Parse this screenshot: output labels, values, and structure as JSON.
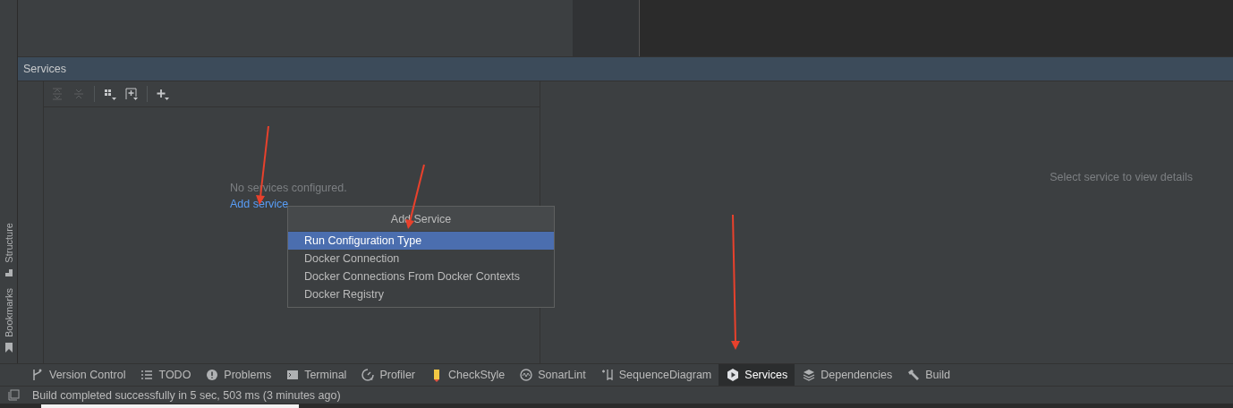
{
  "side_tabs": [
    {
      "label": "Structure",
      "kind": "structure"
    },
    {
      "label": "Bookmarks",
      "kind": "bookmarks"
    }
  ],
  "services_panel": {
    "title": "Services",
    "toolbar": [
      {
        "kind": "expand",
        "disabled": true
      },
      {
        "kind": "collapse",
        "disabled": true
      },
      {
        "kind": "group",
        "disabled": false
      },
      {
        "kind": "new-group",
        "disabled": false
      },
      {
        "kind": "add",
        "disabled": false
      }
    ],
    "empty_text": "No services configured.",
    "add_link": "Add service",
    "details_hint": "Select service to view details"
  },
  "popup": {
    "title": "Add Service",
    "items": [
      {
        "label": "Run Configuration Type",
        "selected": true
      },
      {
        "label": "Docker Connection",
        "selected": false
      },
      {
        "label": "Docker Connections From Docker Contexts",
        "selected": false
      },
      {
        "label": "Docker Registry",
        "selected": false
      }
    ]
  },
  "tool_tabs": [
    {
      "label": "Version Control",
      "kind": "vcs",
      "selected": false
    },
    {
      "label": "TODO",
      "kind": "todo",
      "selected": false
    },
    {
      "label": "Problems",
      "kind": "problems",
      "selected": false
    },
    {
      "label": "Terminal",
      "kind": "terminal",
      "selected": false
    },
    {
      "label": "Profiler",
      "kind": "profiler",
      "selected": false
    },
    {
      "label": "CheckStyle",
      "kind": "checkstyle",
      "selected": false
    },
    {
      "label": "SonarLint",
      "kind": "sonarlint",
      "selected": false
    },
    {
      "label": "SequenceDiagram",
      "kind": "sequence",
      "selected": false
    },
    {
      "label": "Services",
      "kind": "services",
      "selected": true
    },
    {
      "label": "Dependencies",
      "kind": "dependencies",
      "selected": false
    },
    {
      "label": "Build",
      "kind": "build",
      "selected": false
    }
  ],
  "status_bar": {
    "message": "Build completed successfully in 5 sec, 503 ms (3 minutes ago)"
  }
}
